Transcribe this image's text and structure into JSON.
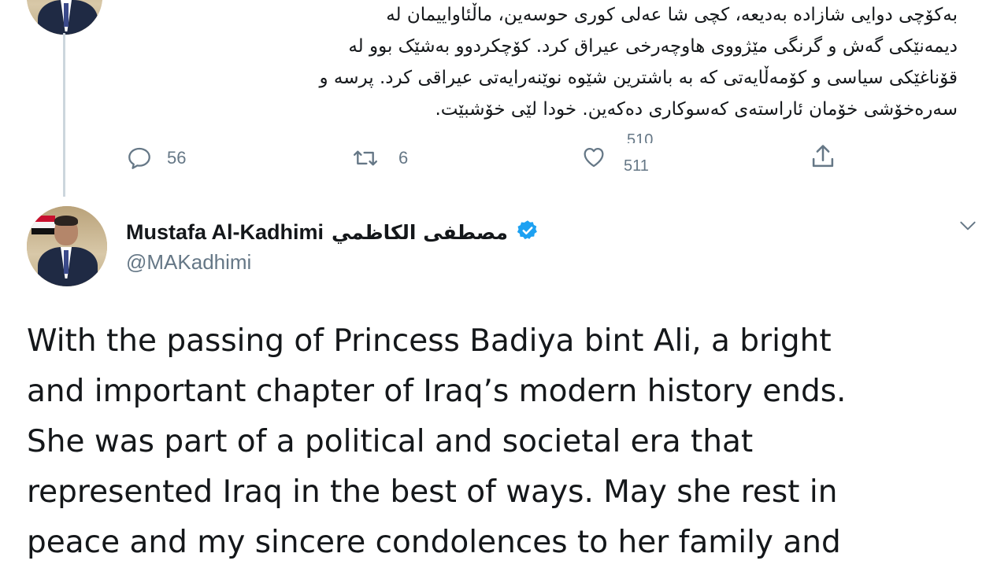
{
  "previous_tweet": {
    "text_lines": [
      "بەکۆچی دوایی شازادە بەدیعە، کچی شا عەلی کوری حوسەین، ماڵئاواییمان لە",
      "دیمەنێکی گەش و گرنگی مێژووی هاوچەرخی عیراق کرد. کۆچکردوو بەشێک بوو لە",
      "قۆناغێکی سیاسی و کۆمەڵایەتی کە بە باشترین شێوە نوێنەرایەتی عیراقی کرد. پرسە و",
      "سەرەخۆشی خۆمان ئاراستەی کەسوکاری دەکەین. خودا لێی خۆشبێت."
    ],
    "reply_count": "56",
    "retweet_count": "6",
    "like_count": "511",
    "like_count_prev": "510",
    "icons": [
      "reply-icon",
      "retweet-icon",
      "like-icon",
      "share-icon"
    ]
  },
  "tweet": {
    "author_name": "Mustafa Al-Kadhimi",
    "author_name_ar": "مصطفى الكاظمي",
    "handle": "@MAKadhimi",
    "verified": true,
    "text_lines": [
      "With the passing of Princess Badiya bint Ali, a bright",
      "and important chapter of Iraq’s modern history ends.",
      "She was part of a political and societal era that",
      "represented Iraq in the best of ways. May she rest in",
      "peace and my sincere condolences to her family and"
    ]
  },
  "colors": {
    "text": "#14171a",
    "secondary": "#657786",
    "verified_blue": "#1da1f2",
    "thread_line": "#ccd6dd"
  }
}
